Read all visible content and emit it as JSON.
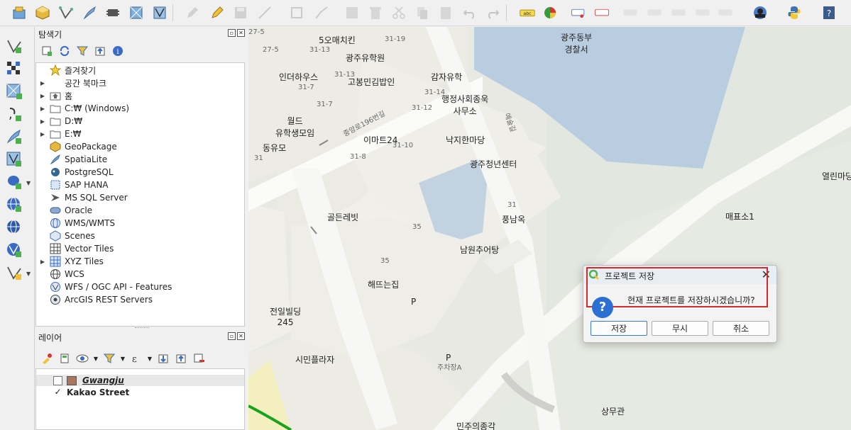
{
  "toolbar": {
    "icons": [
      "open-data-source-manager",
      "new-geopackage-layer",
      "digitize-vertex",
      "new-spatialite-layer",
      "new-temporary-layer",
      "new-virtual-layer",
      "new-mesh-layer",
      "toggle-editing",
      "save-edits",
      "digitize",
      "vertex-tool",
      "advanced-digitizing",
      "attribute-table",
      "delete-selected",
      "cut",
      "copy",
      "paste",
      "undo",
      "redo",
      "label",
      "diagram",
      "pin-labels",
      "show-hide-labels",
      "layer-labeling",
      "python-console",
      "help"
    ],
    "label_abc": "abc"
  },
  "browser_panel": {
    "title": "탐색기",
    "items": [
      {
        "label": "즐겨찾기",
        "icon": "star-icon",
        "expandable": false
      },
      {
        "label": "공간 북마크",
        "icon": "bookmark-icon",
        "expandable": true
      },
      {
        "label": "홈",
        "icon": "home-folder-icon",
        "expandable": true
      },
      {
        "label": "C:₩ (Windows)",
        "icon": "folder-icon",
        "expandable": true
      },
      {
        "label": "D:₩",
        "icon": "folder-icon",
        "expandable": true
      },
      {
        "label": "E:₩",
        "icon": "folder-icon",
        "expandable": true
      },
      {
        "label": "GeoPackage",
        "icon": "geopackage-icon",
        "expandable": false
      },
      {
        "label": "SpatiaLite",
        "icon": "spatialite-icon",
        "expandable": false
      },
      {
        "label": "PostgreSQL",
        "icon": "postgresql-icon",
        "expandable": false
      },
      {
        "label": "SAP HANA",
        "icon": "sap-hana-icon",
        "expandable": false
      },
      {
        "label": "MS SQL Server",
        "icon": "mssql-icon",
        "expandable": false
      },
      {
        "label": "Oracle",
        "icon": "oracle-icon",
        "expandable": false
      },
      {
        "label": "WMS/WMTS",
        "icon": "wms-icon",
        "expandable": false
      },
      {
        "label": "Scenes",
        "icon": "scenes-icon",
        "expandable": false
      },
      {
        "label": "Vector Tiles",
        "icon": "vector-tiles-icon",
        "expandable": false
      },
      {
        "label": "XYZ Tiles",
        "icon": "xyz-tiles-icon",
        "expandable": true
      },
      {
        "label": "WCS",
        "icon": "wcs-icon",
        "expandable": false
      },
      {
        "label": "WFS / OGC API - Features",
        "icon": "wfs-icon",
        "expandable": false
      },
      {
        "label": "ArcGIS REST Servers",
        "icon": "arcgis-icon",
        "expandable": false
      }
    ]
  },
  "layers_panel": {
    "title": "레이어",
    "layers": [
      {
        "name": "Gwangju",
        "checked": false,
        "color": "#a8765e",
        "italic": true
      },
      {
        "name": "Kakao Street",
        "checked": true,
        "bold": true
      }
    ]
  },
  "map": {
    "labels": [
      {
        "text": "광주동부\n경찰서",
        "kind": "big"
      },
      {
        "text": "5오매치킨",
        "kind": "big"
      },
      {
        "text": "광주유학원",
        "kind": "big"
      },
      {
        "text": "인더하우스",
        "kind": "big"
      },
      {
        "text": "고봉민김밥인",
        "kind": "big"
      },
      {
        "text": "감자유학",
        "kind": "big"
      },
      {
        "text": "행정사회종욱\n사무소",
        "kind": "big"
      },
      {
        "text": "월드\n유학생모임",
        "kind": "big"
      },
      {
        "text": "이마트24",
        "kind": "big"
      },
      {
        "text": "낙지한마당",
        "kind": "big"
      },
      {
        "text": "동유모",
        "kind": "big"
      },
      {
        "text": "광주청년센터",
        "kind": "big"
      },
      {
        "text": "열린마당",
        "kind": "big"
      },
      {
        "text": "골든레빗",
        "kind": "big"
      },
      {
        "text": "풍남옥",
        "kind": "big"
      },
      {
        "text": "매표소1",
        "kind": "big"
      },
      {
        "text": "남원추어탕",
        "kind": "big"
      },
      {
        "text": "해뜨는집",
        "kind": "big"
      },
      {
        "text": "전일빌딩\n245",
        "kind": "big"
      },
      {
        "text": "시민플라자",
        "kind": "big"
      },
      {
        "text": "상무관",
        "kind": "big"
      },
      {
        "text": "민주의종각",
        "kind": "big"
      },
      {
        "text": "P",
        "kind": "big"
      },
      {
        "text": "P",
        "kind": "big"
      },
      {
        "text": "주차장A",
        "kind": "sm"
      },
      {
        "text": "27-5",
        "kind": "sm"
      },
      {
        "text": "27-5",
        "kind": "sm"
      },
      {
        "text": "31-13",
        "kind": "sm"
      },
      {
        "text": "31-19",
        "kind": "sm"
      },
      {
        "text": "31-13",
        "kind": "sm"
      },
      {
        "text": "31-7",
        "kind": "sm"
      },
      {
        "text": "31-7",
        "kind": "sm"
      },
      {
        "text": "31-14",
        "kind": "sm"
      },
      {
        "text": "31-12",
        "kind": "sm"
      },
      {
        "text": "31-10",
        "kind": "sm"
      },
      {
        "text": "31-8",
        "kind": "sm"
      },
      {
        "text": "31",
        "kind": "sm"
      },
      {
        "text": "31",
        "kind": "sm"
      },
      {
        "text": "35",
        "kind": "sm"
      },
      {
        "text": "35",
        "kind": "sm"
      },
      {
        "text": "중앙로196번길",
        "kind": "sm"
      },
      {
        "text": "예술길",
        "kind": "sm"
      }
    ]
  },
  "dialog": {
    "title": "프로젝트 저장",
    "message": "현재 프로젝트를 저장하시겠습니까?",
    "buttons": {
      "save": "저장",
      "discard": "무시",
      "cancel": "취소"
    },
    "close": "✕",
    "question": "?",
    "highlight_color": "#d42a2a"
  }
}
